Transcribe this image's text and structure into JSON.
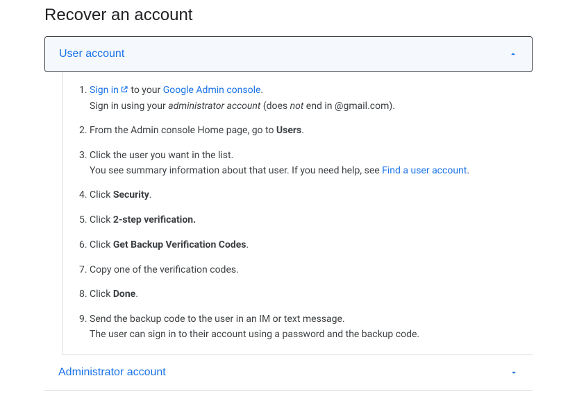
{
  "title": "Recover an account",
  "accordion": {
    "user": {
      "label": "User account",
      "expanded": true
    },
    "admin": {
      "label": "Administrator account",
      "expanded": false
    }
  },
  "step1": {
    "signin": "Sign in",
    "mid": " to your ",
    "console": "Google Admin console",
    "dot": ".",
    "sub_a": "Sign in using your ",
    "sub_b": "administrator account",
    "sub_c": " (does ",
    "sub_d": "not",
    "sub_e": " end in @gmail.com)."
  },
  "step2": {
    "a": "From the Admin console Home page, go to ",
    "b": "Users",
    "c": "."
  },
  "step3": {
    "a": "Click the user you want in the list.",
    "b": "You see summary information about that user. If you need help, see ",
    "link": "Find a user account",
    "c": "."
  },
  "step4": {
    "a": "Click ",
    "b": "Security",
    "c": "."
  },
  "step5": {
    "a": "Click ",
    "b": "2-step verification."
  },
  "step6": {
    "a": "Click ",
    "b": "Get Backup Verification Codes",
    "c": "."
  },
  "step7": {
    "a": "Copy one of the verification codes."
  },
  "step8": {
    "a": "Click ",
    "b": "Done",
    "c": "."
  },
  "step9": {
    "a": "Send the backup code to the user in an IM or text message.",
    "b": "The user can sign in to their account using a password and the backup code."
  }
}
